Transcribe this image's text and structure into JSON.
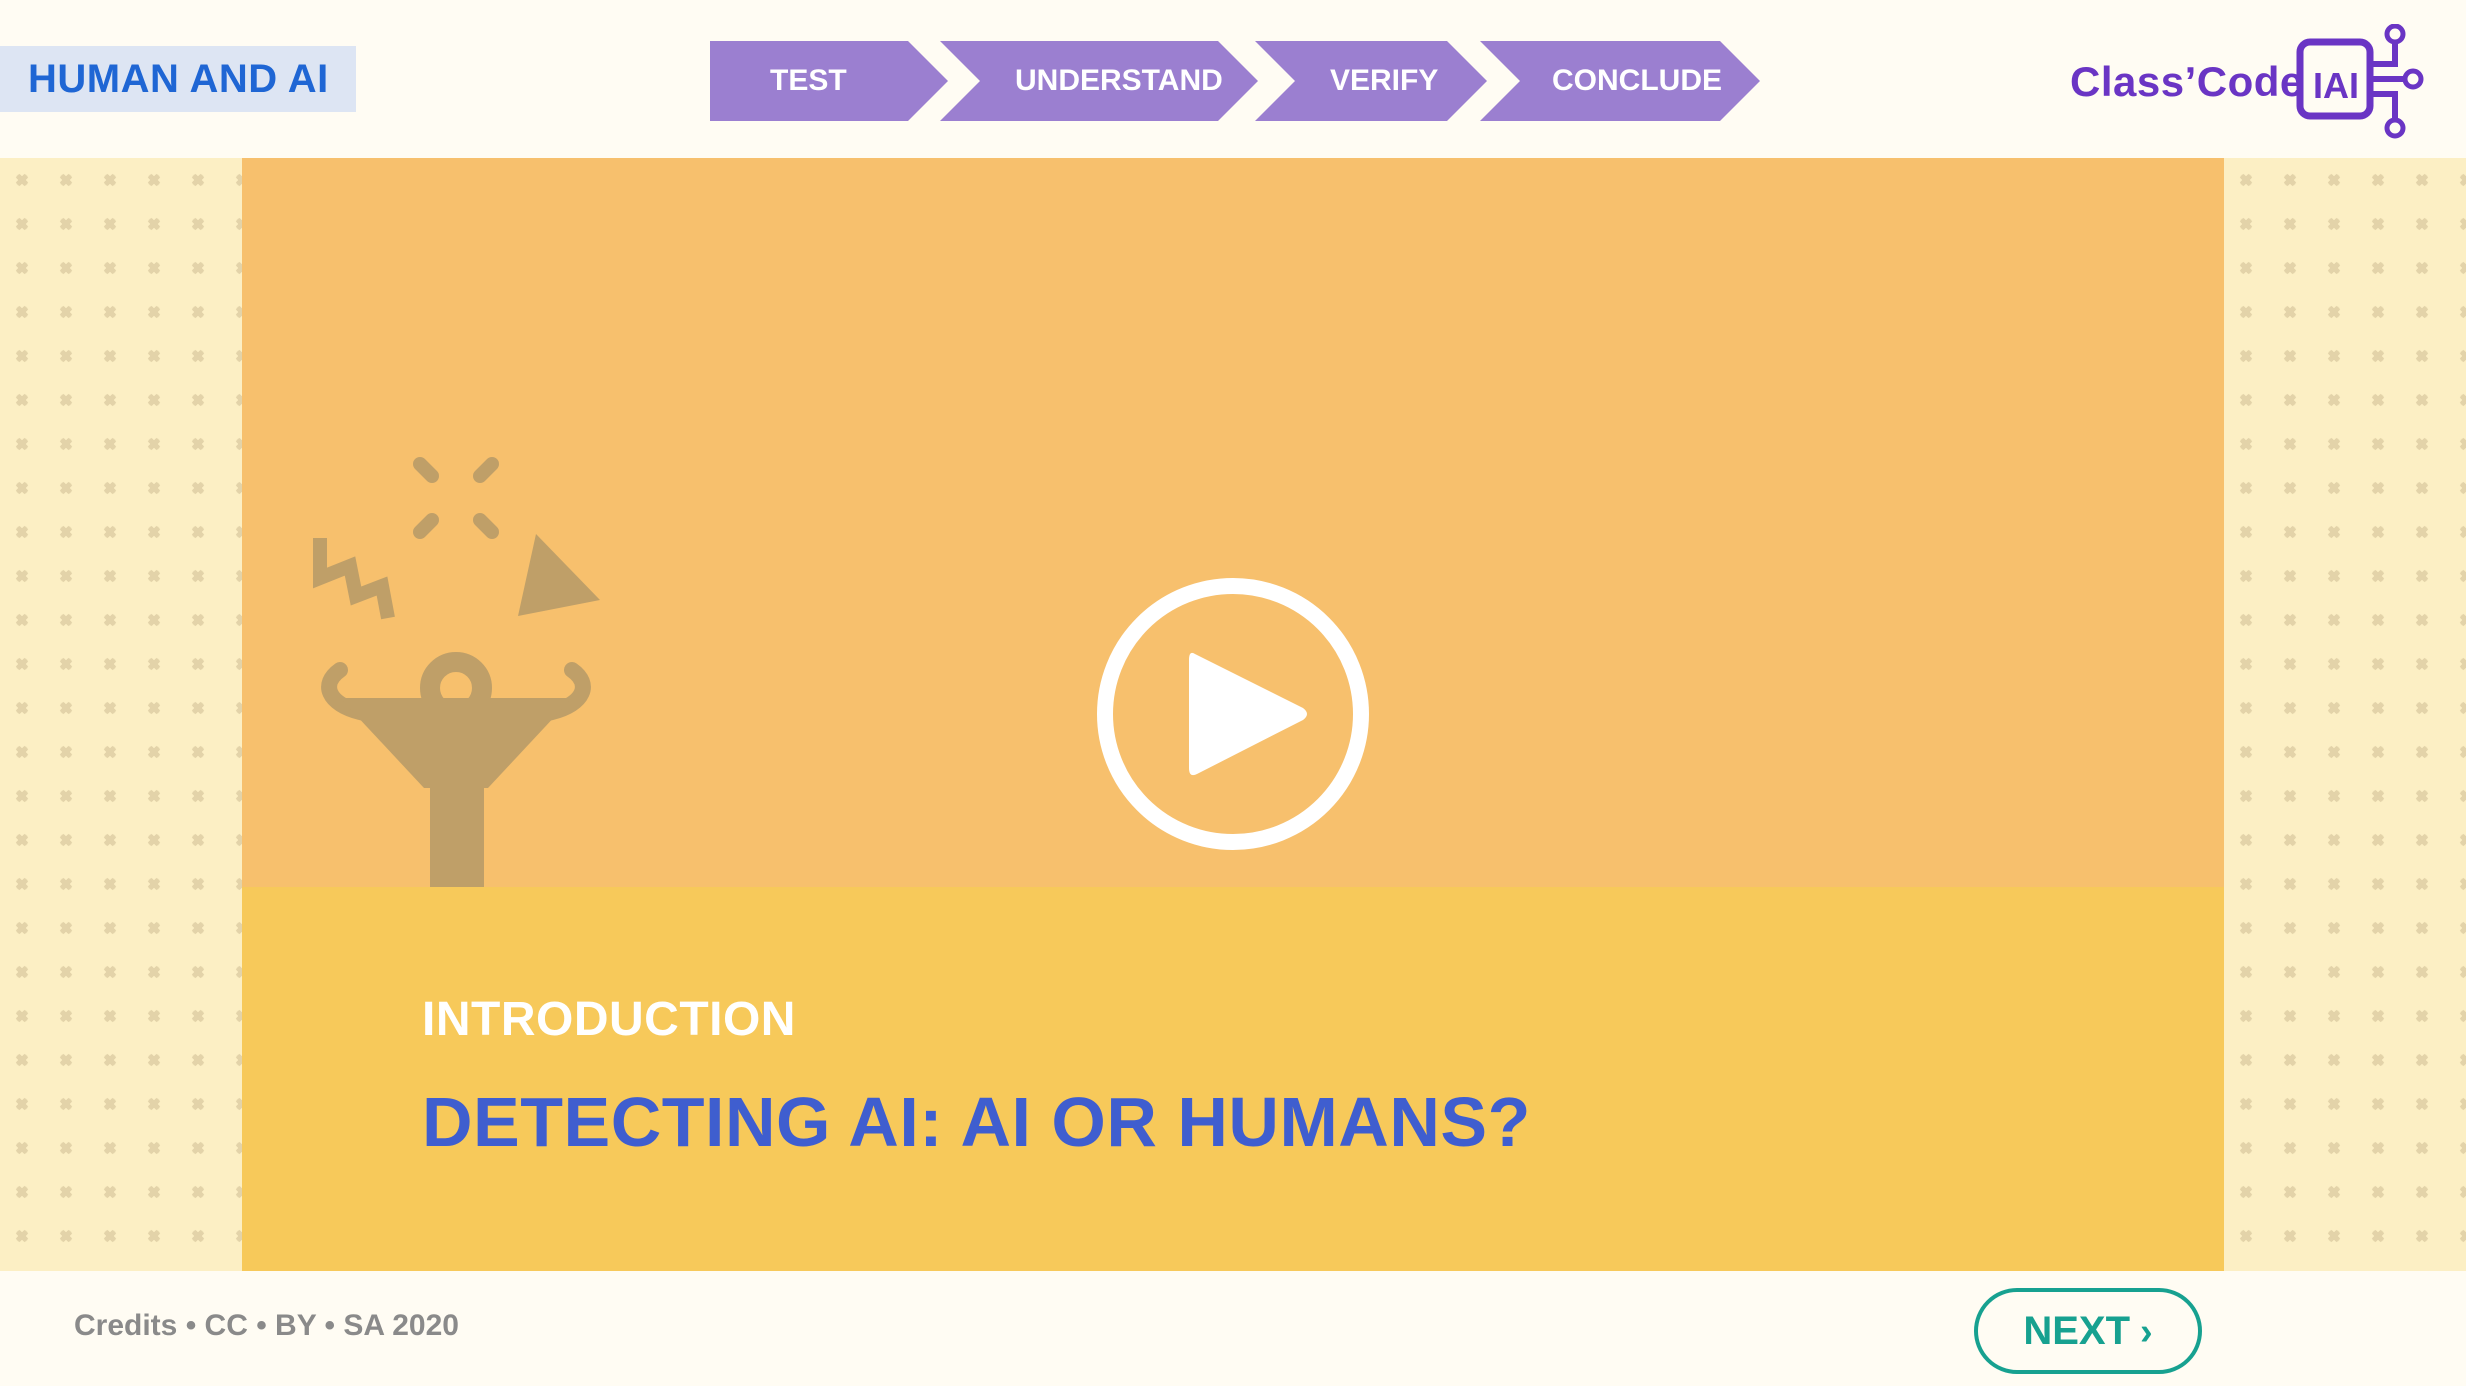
{
  "header": {
    "course_title": "HUMAN AND AI",
    "steps": [
      {
        "label": "TEST"
      },
      {
        "label": "UNDERSTAND"
      },
      {
        "label": "VERIFY"
      },
      {
        "label": "CONCLUDE"
      }
    ],
    "logo": {
      "text": "Class’Code",
      "badge": "IAI"
    }
  },
  "video": {
    "play_icon": "play-icon",
    "illustration_icon": "surprised-person-icon"
  },
  "caption": {
    "eyebrow": "INTRODUCTION",
    "title": "DETECTING AI: AI OR HUMANS?"
  },
  "footer": {
    "credits": "Credits • CC • BY • SA 2020",
    "next_label": "NEXT",
    "next_icon": "chevron-right-icon"
  },
  "colors": {
    "step_fill": "#9b7fd0",
    "video_bg": "#f7c06d",
    "caption_bg": "#f7c95a",
    "title_blue": "#3f5ecf",
    "next_teal": "#17a190",
    "brand_purple": "#6a35c4",
    "course_blue": "#1f66d4"
  }
}
